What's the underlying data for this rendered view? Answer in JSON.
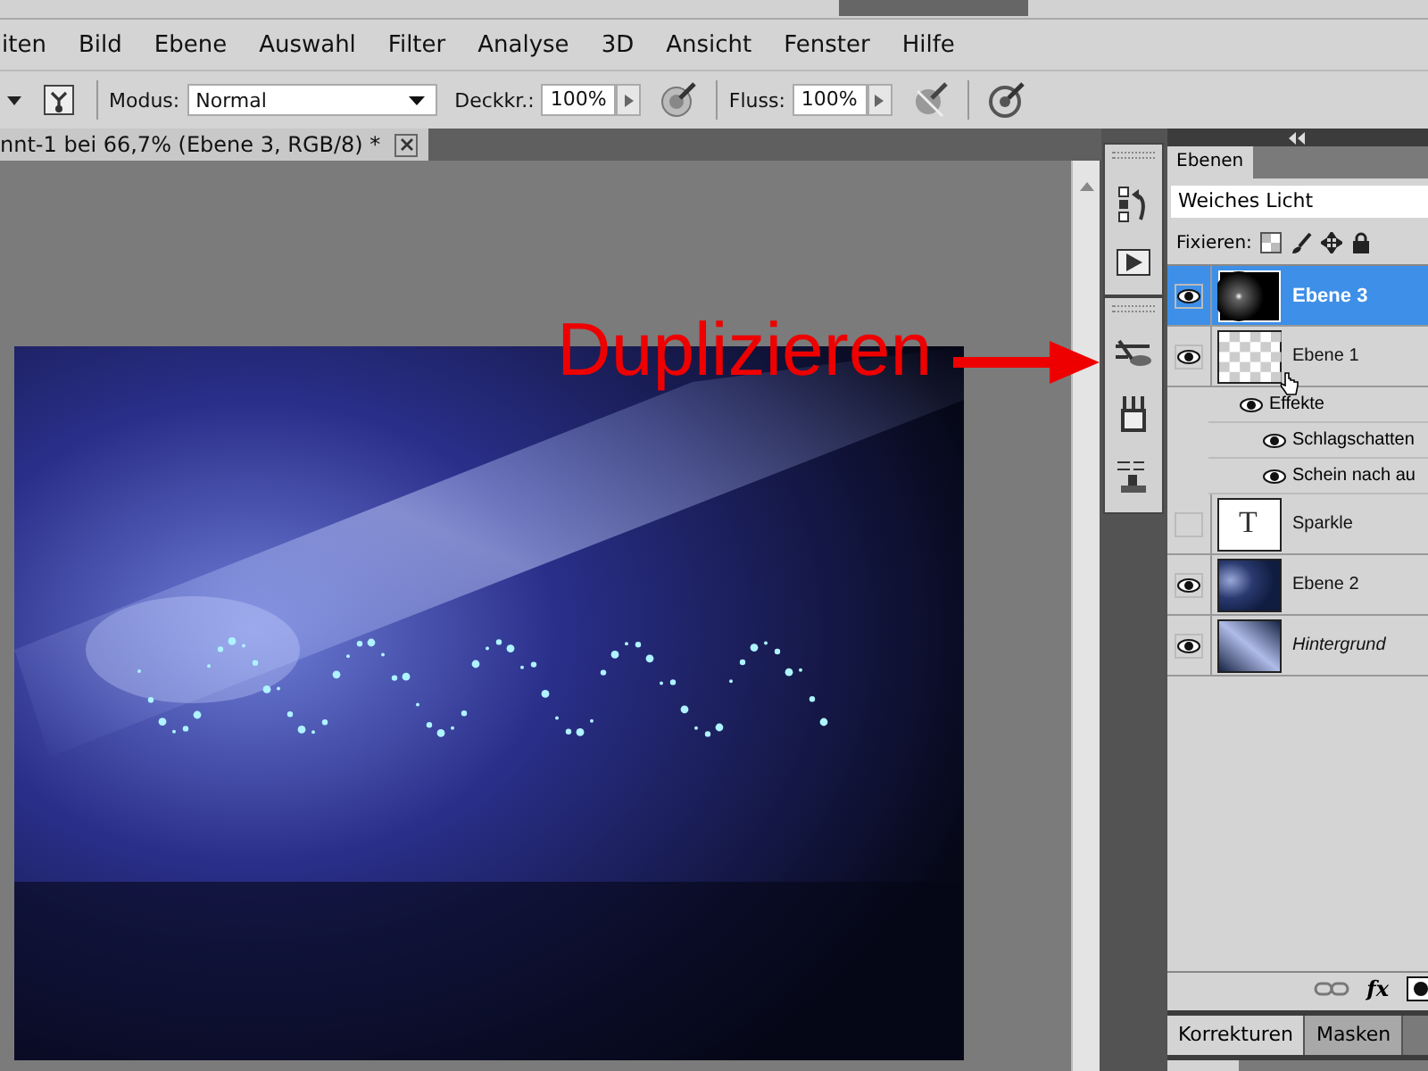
{
  "menu": [
    "iten",
    "Bild",
    "Ebene",
    "Auswahl",
    "Filter",
    "Analyse",
    "3D",
    "Ansicht",
    "Fenster",
    "Hilfe"
  ],
  "options": {
    "mode_label": "Modus:",
    "mode": "Normal",
    "opacity_label": "Deckkr.:",
    "opacity": "100%",
    "flow_label": "Fluss:",
    "flow": "100%"
  },
  "document": {
    "tab_title": "nnt-1 bei 66,7% (Ebene 3, RGB/8) *"
  },
  "annotation": {
    "text": "Duplizieren"
  },
  "layers_panel": {
    "tab": "Ebenen",
    "blend_mode": "Weiches Licht",
    "lock_label": "Fixieren:",
    "layers": [
      {
        "name": "Ebene 3",
        "visible": true,
        "selected": true,
        "kind": "glow"
      },
      {
        "name": "Ebene 1",
        "visible": true,
        "selected": false,
        "kind": "transparent",
        "children": [
          {
            "name": "Effekte",
            "visible": true,
            "children": [
              {
                "name": "Schlagschatten",
                "visible": true
              },
              {
                "name": "Schein nach au",
                "visible": true
              }
            ]
          }
        ]
      },
      {
        "name": "Sparkle",
        "visible": false,
        "selected": false,
        "kind": "text",
        "thumb_text": "T"
      },
      {
        "name": "Ebene 2",
        "visible": true,
        "selected": false,
        "kind": "spot"
      },
      {
        "name": "Hintergrund",
        "visible": true,
        "selected": false,
        "kind": "streak",
        "locked_background": true
      }
    ],
    "fx": "fx",
    "bottom_tabs": [
      {
        "label": "Korrekturen",
        "selected": true
      },
      {
        "label": "Masken",
        "selected": false
      }
    ]
  }
}
